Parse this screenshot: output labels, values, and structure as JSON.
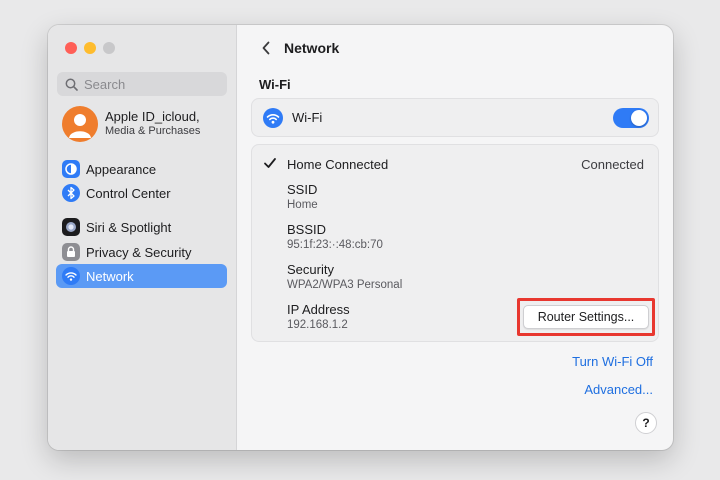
{
  "sidebar": {
    "search_placeholder": "Search",
    "account": {
      "name": "Apple ID_icloud,",
      "subtitle": "Media & Purchases"
    },
    "items": [
      {
        "label": "Appearance",
        "icon": "appearance-icon"
      },
      {
        "label": "Control Center",
        "icon": "control-center-icon"
      },
      {
        "label": "Siri & Spotlight",
        "icon": "siri-icon"
      },
      {
        "label": "Privacy & Security",
        "icon": "lock-icon"
      },
      {
        "label": "Network",
        "icon": "wifi-icon",
        "selected": true
      }
    ]
  },
  "header": {
    "title": "Network"
  },
  "wifi": {
    "section_title": "Wi-Fi",
    "label": "Wi-Fi",
    "enabled": true
  },
  "network": {
    "name": "Home Connected",
    "status": "Connected",
    "details": [
      {
        "label": "SSID",
        "value": "Home"
      },
      {
        "label": "BSSID",
        "value": "95:1f:23:·:48:cb:70"
      },
      {
        "label": "Security",
        "value": "WPA2/WPA3 Personal"
      },
      {
        "label": "IP Address",
        "value": "192.168.1.2"
      }
    ],
    "router_button": "Router Settings..."
  },
  "links": {
    "turn_off": "Turn Wi-Fi Off",
    "advanced": "Advanced..."
  },
  "help_label": "?",
  "colors": {
    "accent": "#2f7bf6",
    "selection": "#5b9af5",
    "highlight": "#e8372f",
    "avatar": "#ef7d2d"
  }
}
